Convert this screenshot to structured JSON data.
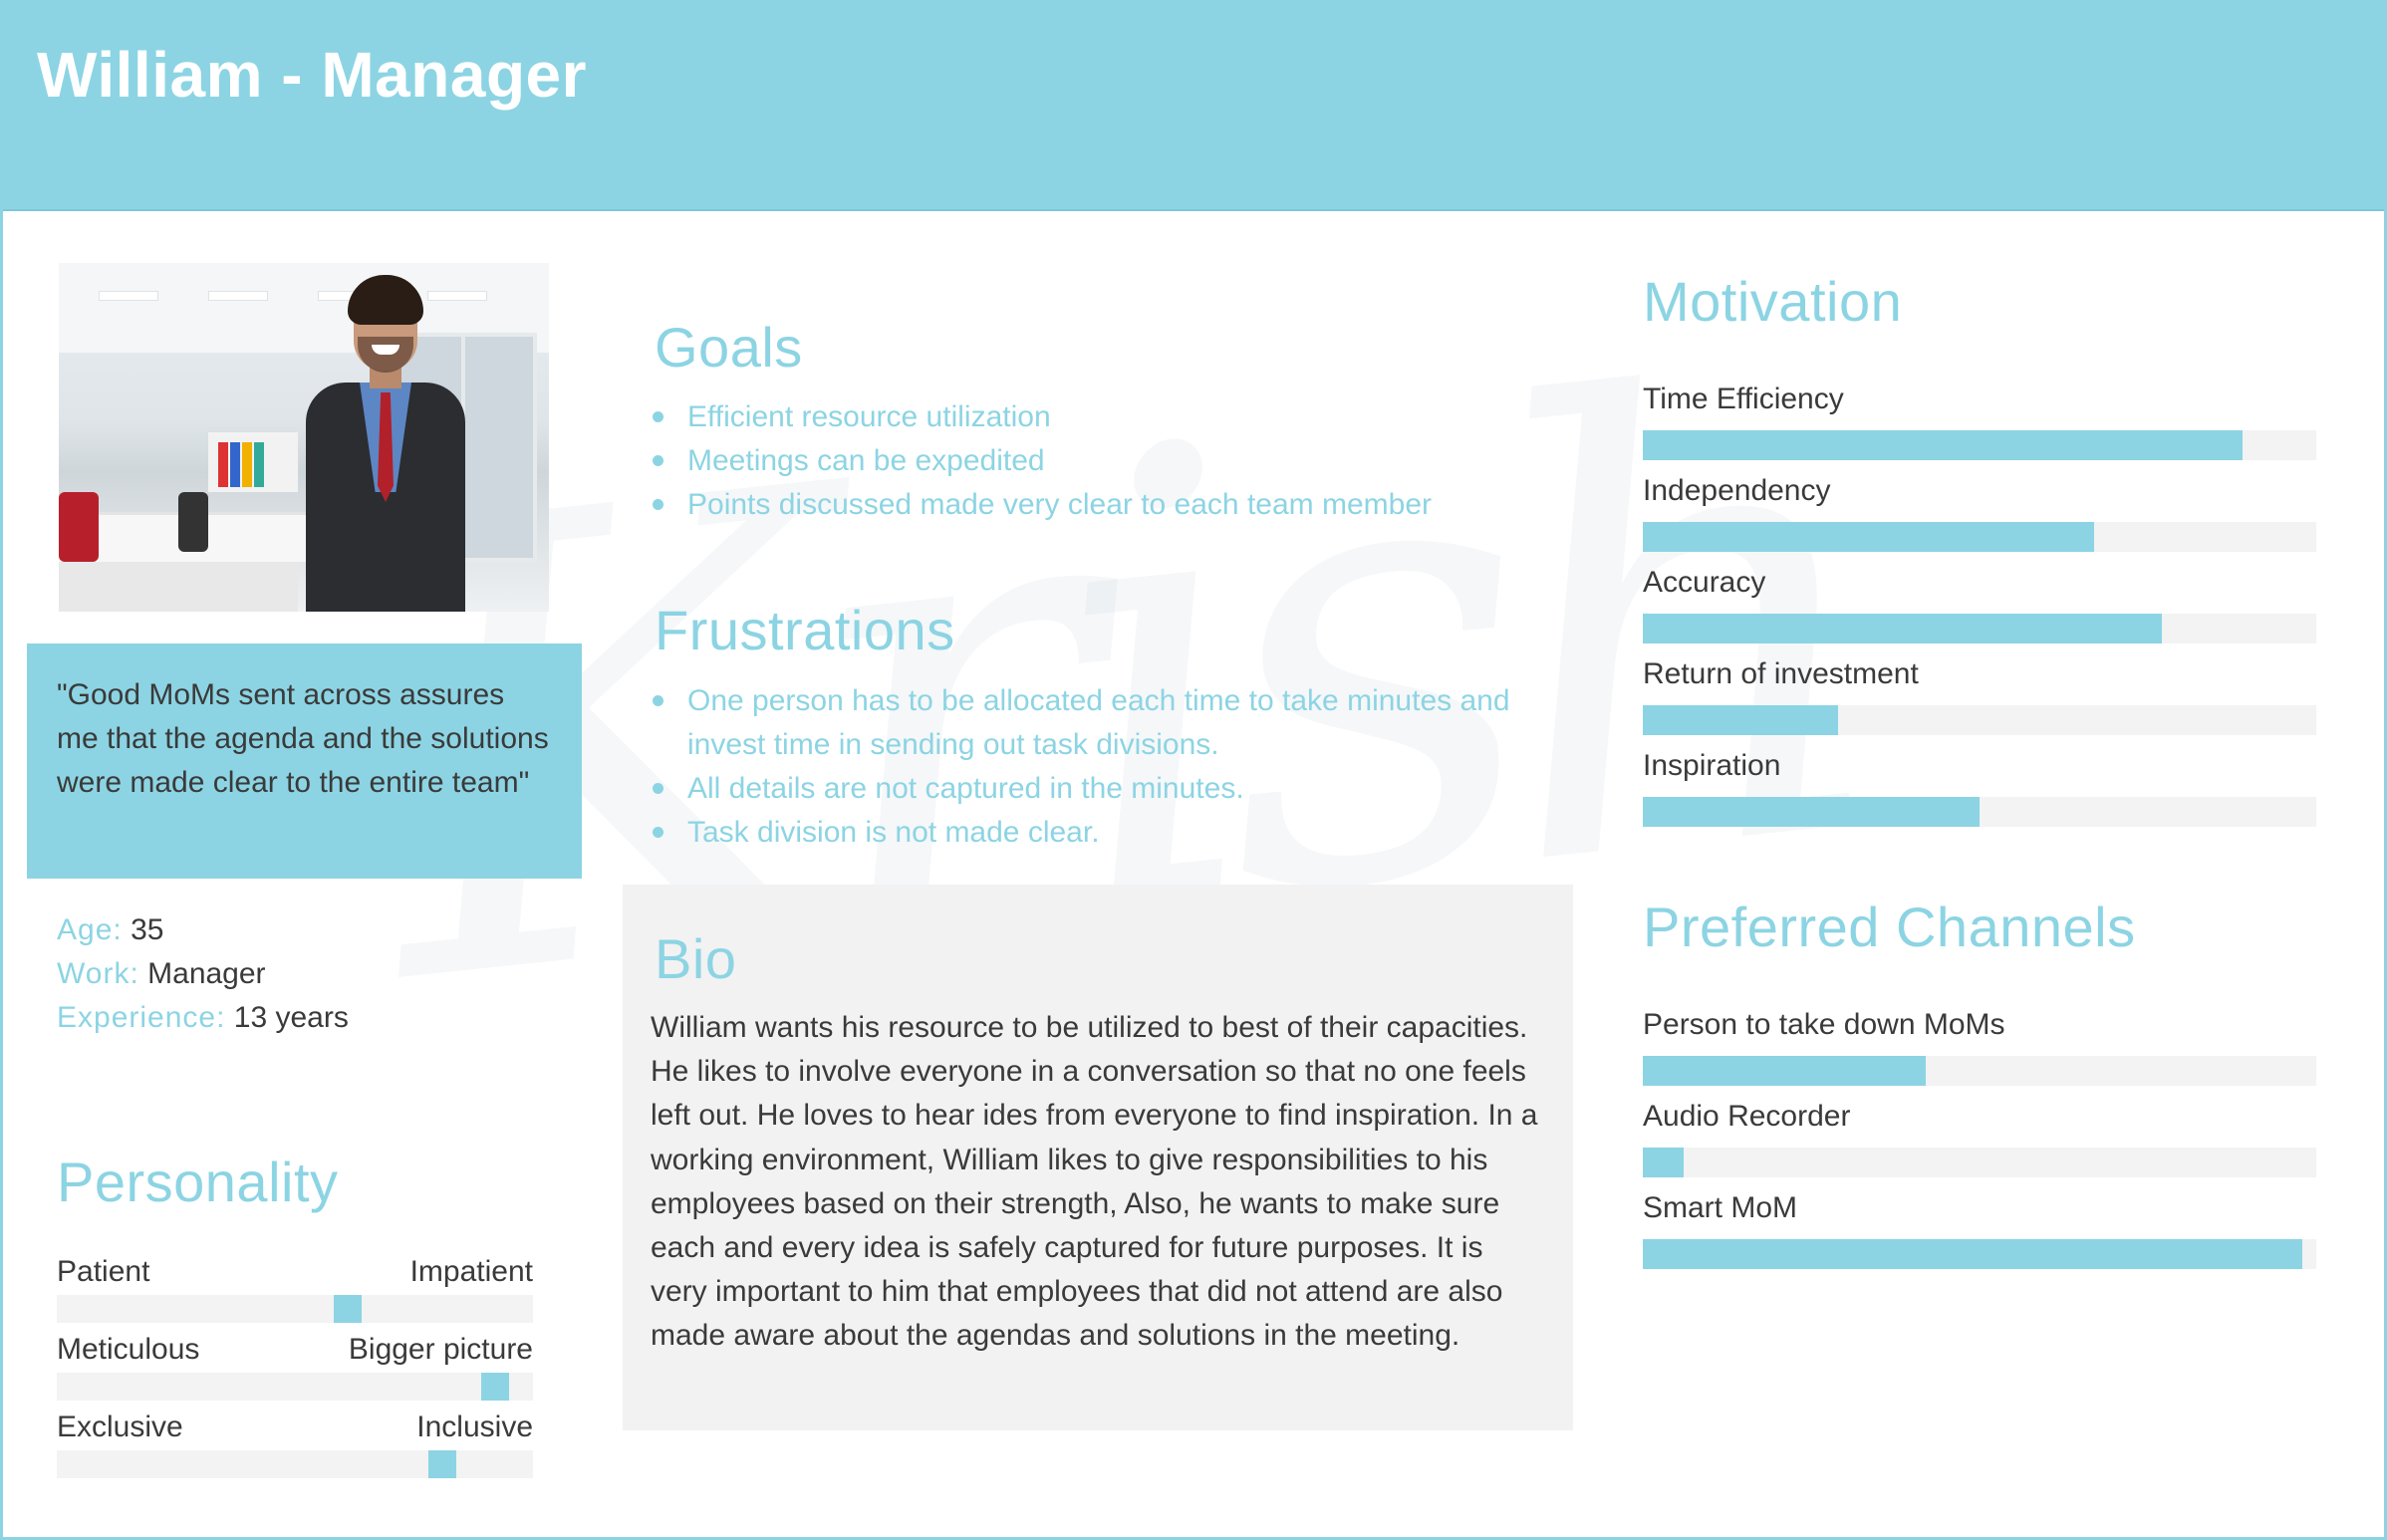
{
  "header": {
    "title": "William - Manager"
  },
  "photo": {
    "alt": "William"
  },
  "quote": {
    "text": "\"Good MoMs sent across assures me that the agenda and the solutions were made clear to the entire team\""
  },
  "facts": [
    {
      "key": "Age:",
      "value": "35"
    },
    {
      "key": "Work:",
      "value": "Manager"
    },
    {
      "key": "Experience:",
      "value": "13 years"
    }
  ],
  "personality": {
    "title": "Personality",
    "traits": [
      {
        "left": "Patient",
        "right": "Impatient",
        "level": 0.61
      },
      {
        "left": "Meticulous",
        "right": "Bigger picture",
        "level": 0.92
      },
      {
        "left": "Exclusive",
        "right": "Inclusive",
        "level": 0.81
      }
    ]
  },
  "goals": {
    "title": "Goals",
    "items": [
      "Efficient resource utilization",
      "Meetings can be expedited",
      "Points discussed made very clear to each team member"
    ]
  },
  "frustrations": {
    "title": "Frustrations",
    "items": [
      "One person has to be allocated each time to take minutes and invest time in sending out task divisions.",
      "All details are not captured in the minutes.",
      "Task division is not made clear."
    ]
  },
  "bio": {
    "title": "Bio",
    "text": "William wants his resource to be utilized to best of their capacities. He likes to involve everyone in a conversation so that no one feels left out. He loves to hear ides from everyone to find inspiration. In a working environment, William likes to give responsibilities to his employees  based on their strength, Also, he wants to make sure each and every idea is safely captured for future purposes. It is very important to him that employees that did not attend are also made aware about the agendas and solutions in the meeting."
  },
  "motivation": {
    "title": "Motivation",
    "items": [
      {
        "label": "Time Efficiency",
        "value": 0.89
      },
      {
        "label": "Independency",
        "value": 0.67
      },
      {
        "label": "Accuracy",
        "value": 0.77
      },
      {
        "label": "Return of investment",
        "value": 0.29
      },
      {
        "label": "Inspiration",
        "value": 0.5
      }
    ]
  },
  "channels": {
    "title": "Preferred Channels",
    "items": [
      {
        "label": "Person to take down MoMs",
        "value": 0.42
      },
      {
        "label": "Audio Recorder",
        "value": 0.06
      },
      {
        "label": "Smart MoM",
        "value": 0.98
      }
    ]
  },
  "colors": {
    "accent": "#8cd4e3",
    "text": "#3a3a3a",
    "track": "#f3f3f3",
    "bio_bg": "#f2f2f2"
  }
}
